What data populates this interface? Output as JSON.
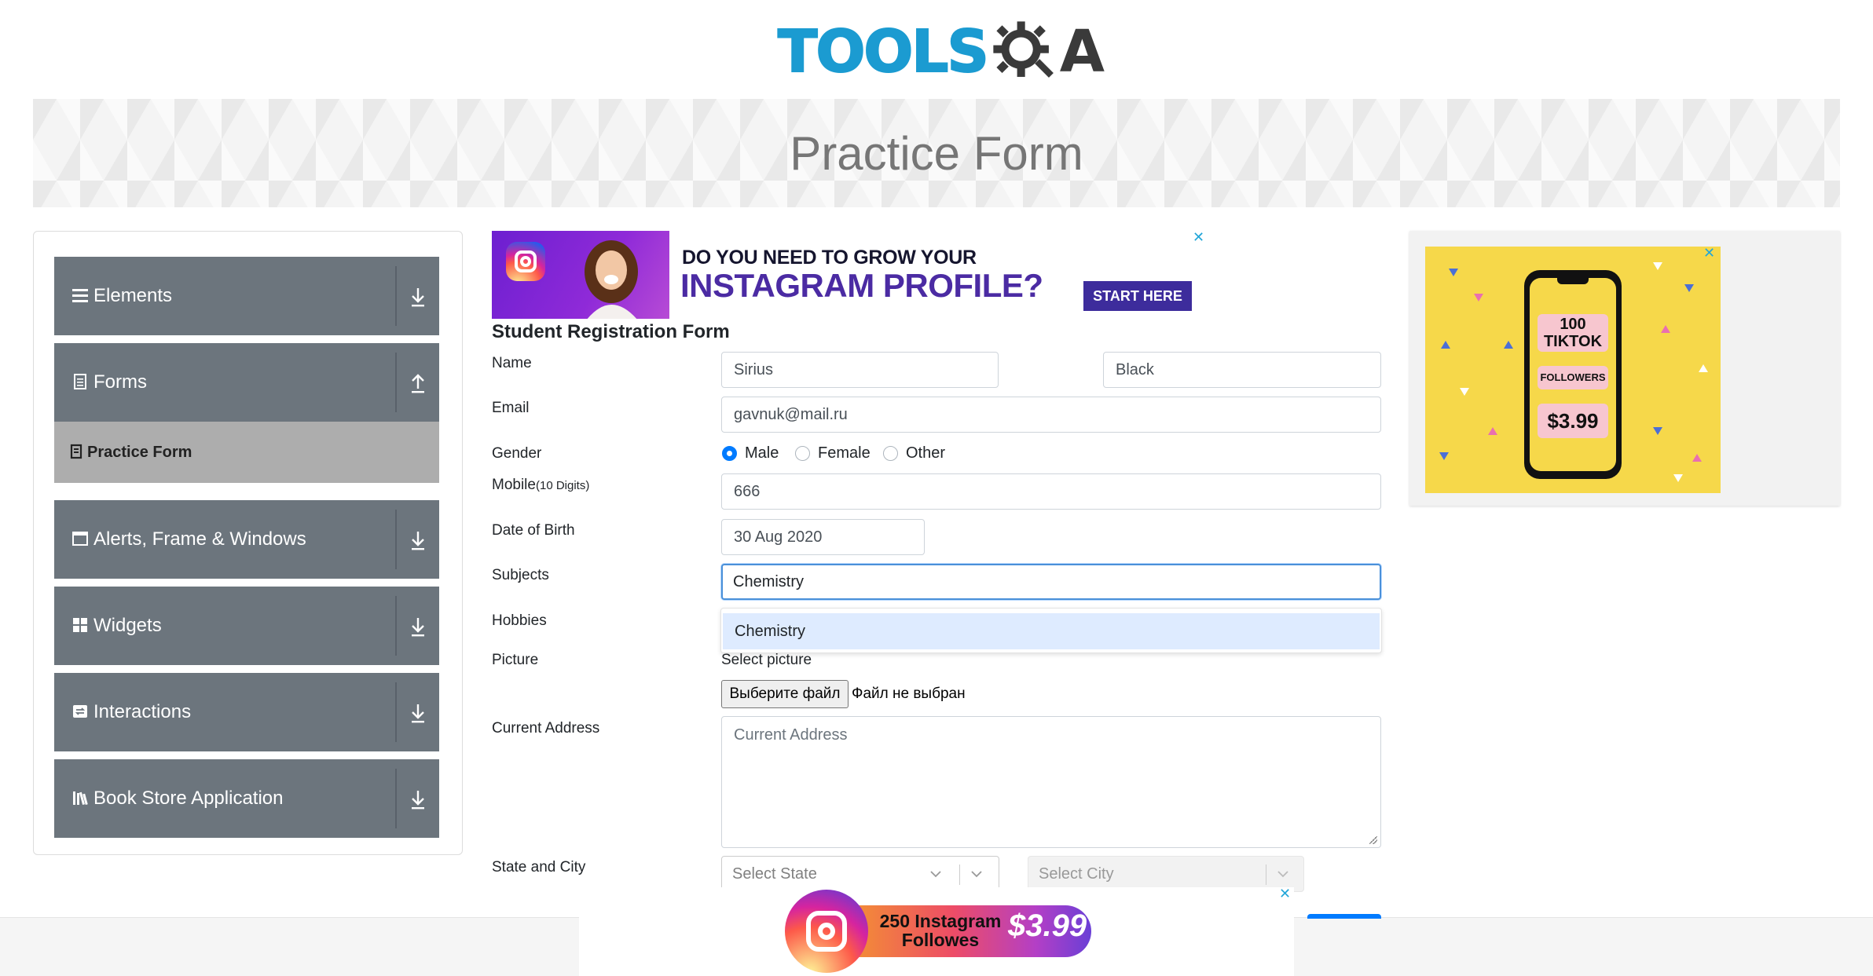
{
  "header": {
    "logo_text": "TOOLS",
    "logo_suffix": "A",
    "banner_title": "Practice Form"
  },
  "sidebar": {
    "groups": [
      {
        "label": "Elements",
        "icon": "hamburger-icon",
        "arrow": "download-arrow-icon"
      },
      {
        "label": "Forms",
        "icon": "document-icon",
        "arrow": "upload-arrow-icon"
      },
      {
        "label": "Alerts, Frame & Windows",
        "icon": "window-icon",
        "arrow": "download-arrow-icon"
      },
      {
        "label": "Widgets",
        "icon": "widgets-icon",
        "arrow": "download-arrow-icon"
      },
      {
        "label": "Interactions",
        "icon": "interactions-icon",
        "arrow": "download-arrow-icon"
      },
      {
        "label": "Book Store Application",
        "icon": "books-icon",
        "arrow": "download-arrow-icon"
      }
    ],
    "sub_item": {
      "label": "Practice Form",
      "icon": "form-icon"
    }
  },
  "ad_top": {
    "line1": "DO YOU NEED TO GROW YOUR",
    "line2": "INSTAGRAM PROFILE?",
    "cta": "START HERE",
    "close": "✕"
  },
  "form": {
    "title": "Student Registration Form",
    "labels": {
      "name": "Name",
      "email": "Email",
      "gender": "Gender",
      "mobile": "Mobile",
      "mobile_hint": "(10 Digits)",
      "dob": "Date of Birth",
      "subjects": "Subjects",
      "hobbies": "Hobbies",
      "picture": "Picture",
      "address": "Current Address",
      "state_city": "State and City"
    },
    "first_name": "Sirius",
    "last_name": "Black",
    "email": "gavnuk@mail.ru",
    "gender_options": [
      "Male",
      "Female",
      "Other"
    ],
    "gender_selected": "Male",
    "mobile": "666",
    "dob": "30 Aug 2020",
    "subjects_input": "Chemistry",
    "subjects_suggestion": "Chemistry",
    "picture_caption": "Select picture",
    "file_button": "Выберите файл",
    "file_status": "Файл не выбран",
    "address_placeholder": "Current Address",
    "state_placeholder": "Select State",
    "city_placeholder": "Select City"
  },
  "ad_right": {
    "l1": "100",
    "l2": "TIKTOK",
    "l3": "FOLLOWERS",
    "price": "$3.99",
    "close": "✕"
  },
  "ad_bottom": {
    "text": "250 Instagram Followes",
    "price": "$3.99",
    "close": "✕"
  },
  "colors": {
    "accent": "#007bff",
    "sidebar_bg": "#6c757d",
    "logo_blue": "#1b9bd1"
  }
}
